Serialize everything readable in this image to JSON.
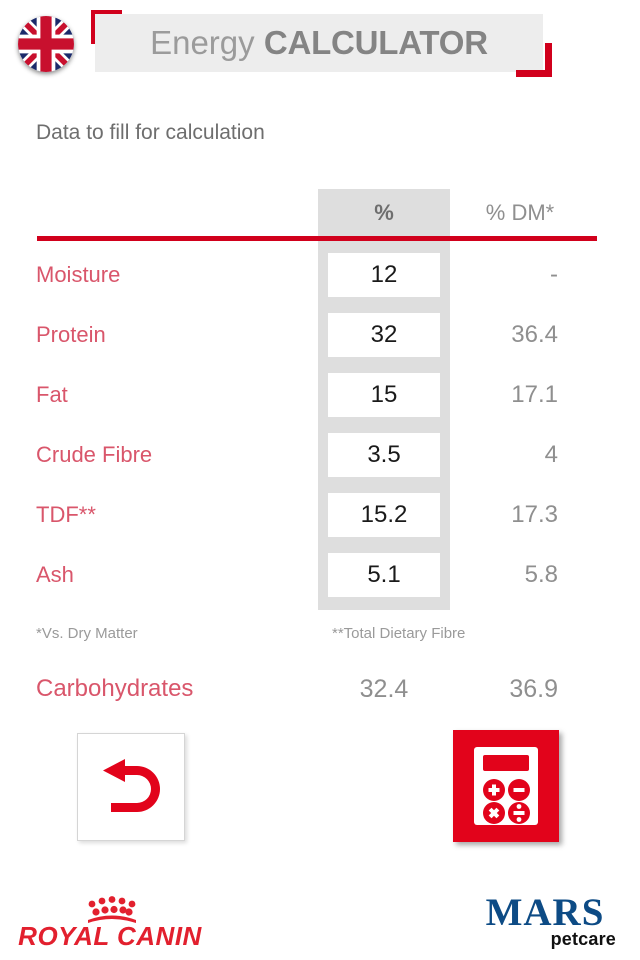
{
  "header": {
    "flag_icon": "uk-flag-icon",
    "title_light": "Energy",
    "title_bold": "CALCULATOR"
  },
  "subtitle": "Data to fill for calculation",
  "table": {
    "col_header_input": "%",
    "col_header_dm": "% DM*",
    "rows": [
      {
        "label": "Moisture",
        "value": "12",
        "dm": "-"
      },
      {
        "label": "Protein",
        "value": "32",
        "dm": "36.4"
      },
      {
        "label": "Fat",
        "value": "15",
        "dm": "17.1"
      },
      {
        "label": "Crude Fibre",
        "value": "3.5",
        "dm": "4"
      },
      {
        "label": "TDF**",
        "value": "15.2",
        "dm": "17.3"
      },
      {
        "label": "Ash",
        "value": "5.1",
        "dm": "5.8"
      }
    ]
  },
  "notes": {
    "dm": "*Vs. Dry Matter",
    "tdf": "**Total Dietary Fibre"
  },
  "carbohydrates": {
    "label": "Carbohydrates",
    "value": "32.4",
    "dm": "36.9"
  },
  "buttons": {
    "back_icon": "back-arrow-icon",
    "calculate_icon": "calculator-icon"
  },
  "logos": {
    "royal_canin": "ROYAL CANIN",
    "mars": "MARS",
    "mars_sub": "petcare"
  },
  "colors": {
    "brand_red": "#d1001c",
    "label_red": "#d9566b",
    "grey_band": "#dedede",
    "title_grey": "#9b9b9b",
    "mars_blue": "#0d4b85"
  }
}
